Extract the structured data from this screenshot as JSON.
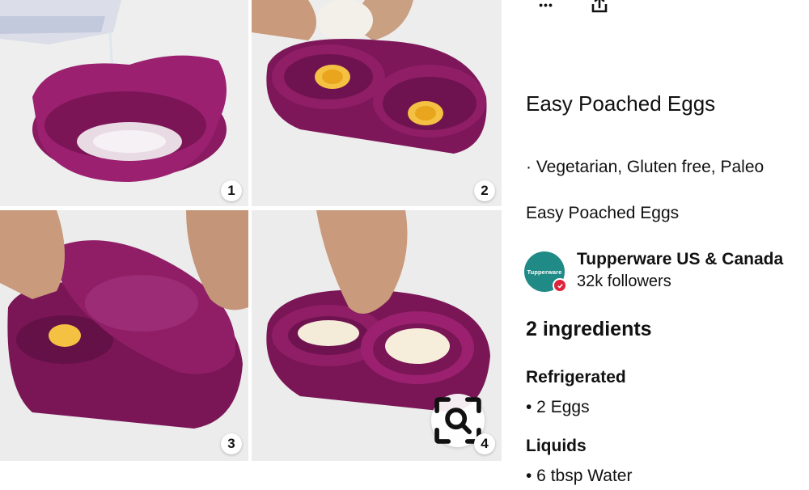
{
  "toolbar": {
    "more_icon": "more-horizontal-icon",
    "share_icon": "share-upload-icon",
    "more_glyph": "•••"
  },
  "images": {
    "steps": [
      {
        "number": "1"
      },
      {
        "number": "2"
      },
      {
        "number": "3"
      },
      {
        "number": "4"
      }
    ],
    "brand_color": "#7a1656",
    "lens_icon": "visual-search-icon"
  },
  "pin": {
    "title": "Easy Poached Eggs",
    "tags": "· Vegetarian, Gluten free, Paleo",
    "description": "Easy Poached Eggs"
  },
  "creator": {
    "avatar_text": "Tupperware",
    "avatar_color": "#1f8a86",
    "name": "Tupperware US & Canada",
    "followers": "32k followers",
    "verified_color": "#e0223a"
  },
  "ingredients": {
    "heading": "2 ingredients",
    "sections": [
      {
        "title": "Refrigerated",
        "items": [
          "• 2 Eggs"
        ]
      },
      {
        "title": "Liquids",
        "items": [
          "• 6 tbsp Water"
        ]
      }
    ]
  }
}
